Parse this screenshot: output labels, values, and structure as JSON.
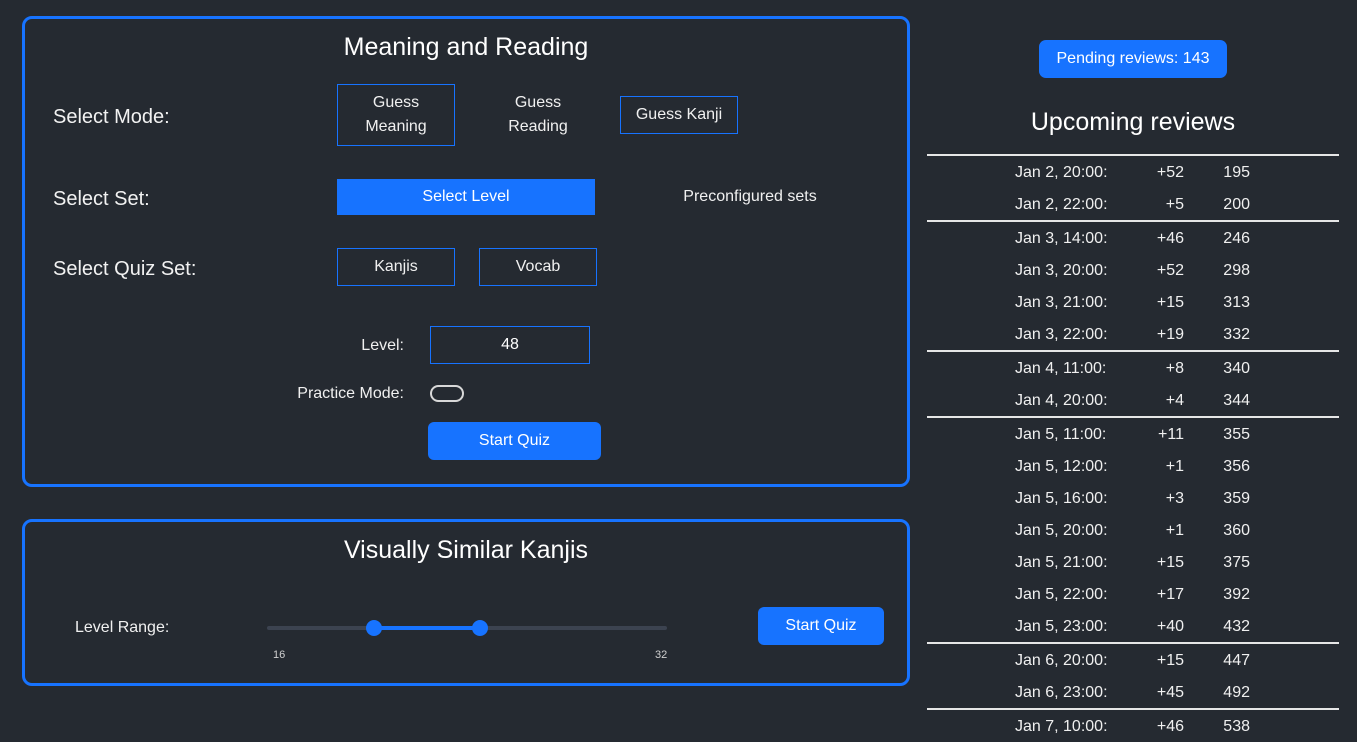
{
  "quiz": {
    "title": "Meaning and Reading",
    "mode_label": "Select Mode:",
    "modes": [
      "Guess\nMeaning",
      "Guess\nReading",
      "Guess Kanji"
    ],
    "set_label": "Select Set:",
    "sets": [
      "Select Level",
      "Preconfigured sets"
    ],
    "quiz_set_label": "Select Quiz Set:",
    "quiz_sets": [
      "Kanjis",
      "Vocab"
    ],
    "level_label": "Level:",
    "level_value": "48",
    "practice_label": "Practice Mode:",
    "practice_on": false,
    "start_label": "Start Quiz"
  },
  "similar": {
    "title": "Visually Similar Kanjis",
    "range_label": "Level Range:",
    "range_min": 16,
    "range_max": 32,
    "min_label": "16",
    "max_label": "32",
    "start_label": "Start Quiz"
  },
  "colors": {
    "accent": "#1773ff",
    "background": "#252a31"
  },
  "pending": {
    "label": "Pending reviews: 143"
  },
  "upcoming": {
    "title": "Upcoming reviews",
    "groups": [
      [
        {
          "time": "Jan 2, 20:00:",
          "delta": "+52",
          "total": "195"
        },
        {
          "time": "Jan 2, 22:00:",
          "delta": "+5",
          "total": "200"
        }
      ],
      [
        {
          "time": "Jan 3, 14:00:",
          "delta": "+46",
          "total": "246"
        },
        {
          "time": "Jan 3, 20:00:",
          "delta": "+52",
          "total": "298"
        },
        {
          "time": "Jan 3, 21:00:",
          "delta": "+15",
          "total": "313"
        },
        {
          "time": "Jan 3, 22:00:",
          "delta": "+19",
          "total": "332"
        }
      ],
      [
        {
          "time": "Jan 4, 11:00:",
          "delta": "+8",
          "total": "340"
        },
        {
          "time": "Jan 4, 20:00:",
          "delta": "+4",
          "total": "344"
        }
      ],
      [
        {
          "time": "Jan 5, 11:00:",
          "delta": "+11",
          "total": "355"
        },
        {
          "time": "Jan 5, 12:00:",
          "delta": "+1",
          "total": "356"
        },
        {
          "time": "Jan 5, 16:00:",
          "delta": "+3",
          "total": "359"
        },
        {
          "time": "Jan 5, 20:00:",
          "delta": "+1",
          "total": "360"
        },
        {
          "time": "Jan 5, 21:00:",
          "delta": "+15",
          "total": "375"
        },
        {
          "time": "Jan 5, 22:00:",
          "delta": "+17",
          "total": "392"
        },
        {
          "time": "Jan 5, 23:00:",
          "delta": "+40",
          "total": "432"
        }
      ],
      [
        {
          "time": "Jan 6, 20:00:",
          "delta": "+15",
          "total": "447"
        },
        {
          "time": "Jan 6, 23:00:",
          "delta": "+45",
          "total": "492"
        }
      ],
      [
        {
          "time": "Jan 7, 10:00:",
          "delta": "+46",
          "total": "538"
        }
      ]
    ]
  }
}
